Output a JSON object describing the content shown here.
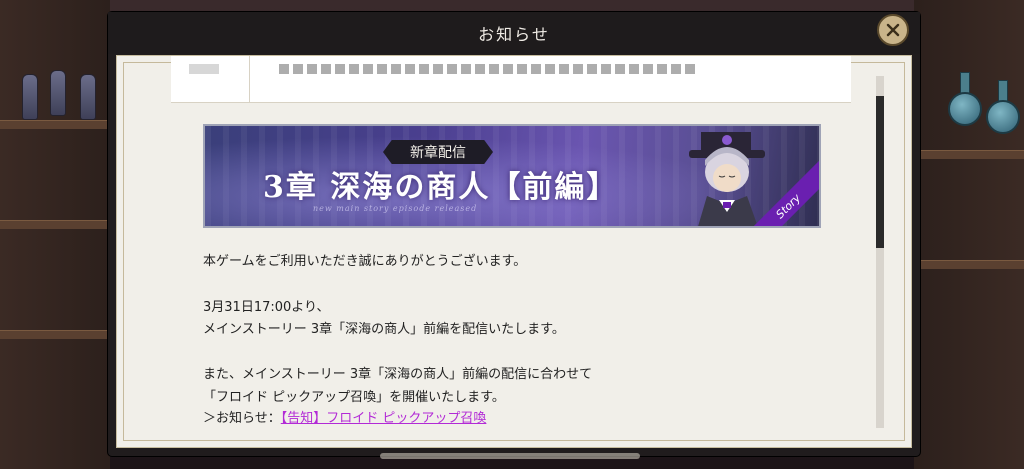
{
  "dialog": {
    "title": "お知らせ",
    "close_icon": "close-icon"
  },
  "banner": {
    "tag": "新章配信",
    "title": "3章 深海の商人【前編】",
    "subtitle": "new main story episode released",
    "ribbon": "Story"
  },
  "body": {
    "line1": "本ゲームをご利用いただき誠にありがとうございます。",
    "line2": "3月31日17:00より、",
    "line3": "メインストーリー 3章「深海の商人」前編を配信いたします。",
    "line4": "また、メインストーリー 3章「深海の商人」前編の配信に合わせて",
    "line5": "「フロイド ピックアップ召喚」を開催いたします。",
    "line6_prefix": "＞お知らせ：",
    "line6_link": "【告知】フロイド ピックアップ召喚"
  },
  "colors": {
    "link": "#b22ad6",
    "close_button": "#c9b48a",
    "panel": "#f1efe9"
  }
}
